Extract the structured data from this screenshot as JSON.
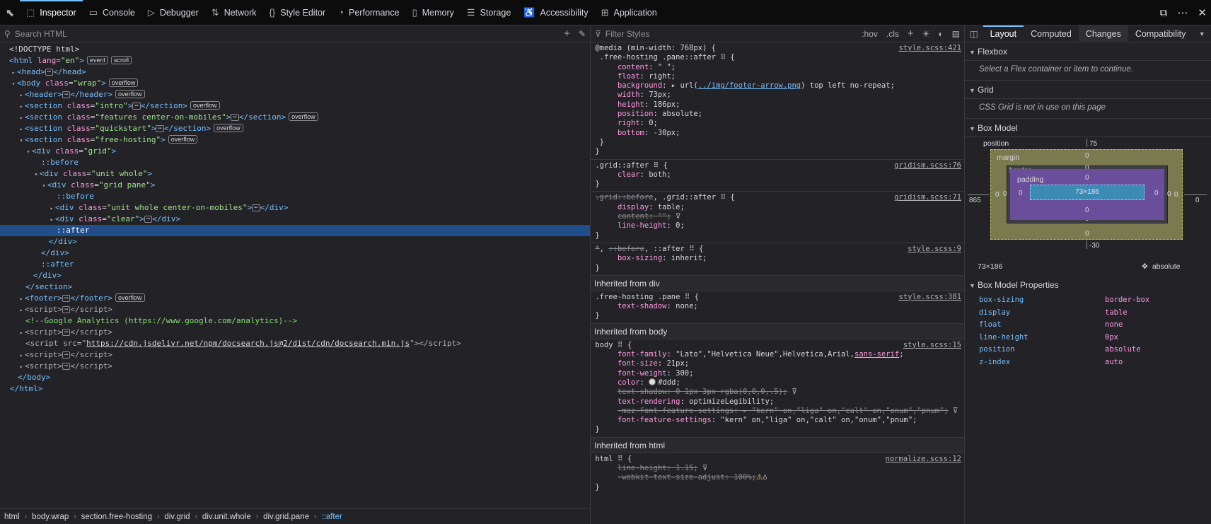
{
  "toolbar": {
    "tabs": [
      {
        "label": "Inspector",
        "icon": "inspector-icon",
        "glyph": "⬚"
      },
      {
        "label": "Console",
        "icon": "console-icon",
        "glyph": "▭"
      },
      {
        "label": "Debugger",
        "icon": "debugger-icon",
        "glyph": "▷"
      },
      {
        "label": "Network",
        "icon": "network-icon",
        "glyph": "⇅"
      },
      {
        "label": "Style Editor",
        "icon": "style-editor-icon",
        "glyph": "{}"
      },
      {
        "label": "Performance",
        "icon": "performance-icon",
        "glyph": "◔"
      },
      {
        "label": "Memory",
        "icon": "memory-icon",
        "glyph": "▯"
      },
      {
        "label": "Storage",
        "icon": "storage-icon",
        "glyph": "☰"
      },
      {
        "label": "Accessibility",
        "icon": "accessibility-icon",
        "glyph": "♿"
      },
      {
        "label": "Application",
        "icon": "application-icon",
        "glyph": "⊞"
      }
    ]
  },
  "markup": {
    "search_placeholder": "Search HTML",
    "breadcrumbs": [
      "html",
      "body.wrap",
      "section.free-hosting",
      "div.grid",
      "div.unit.whole",
      "div.grid.pane",
      "::after"
    ]
  },
  "rules": {
    "filter_placeholder": "Filter Styles",
    "hov": ":hov",
    "cls": ".cls",
    "inherited_div": "Inherited from div",
    "inherited_body": "Inherited from body",
    "inherited_html": "Inherited from html"
  },
  "layout": {
    "tabs": [
      "Layout",
      "Computed",
      "Changes",
      "Compatibility"
    ],
    "flexbox": "Flexbox",
    "flexbox_msg": "Select a Flex container or item to continue.",
    "grid": "Grid",
    "grid_msg": "CSS Grid is not in use on this page",
    "box_model": "Box Model",
    "position_label": "position",
    "margin_label": "margin",
    "border_label": "border",
    "padding_label": "padding",
    "content_size": "73×186",
    "pos_top": "75",
    "pos_bottom": "-30",
    "pos_left": "865",
    "pos_right": "0",
    "zero": "0",
    "size": "73×186",
    "position_value": "absolute",
    "props_title": "Box Model Properties",
    "props": [
      {
        "k": "box-sizing",
        "v": "border-box"
      },
      {
        "k": "display",
        "v": "table"
      },
      {
        "k": "float",
        "v": "none"
      },
      {
        "k": "line-height",
        "v": "0px"
      },
      {
        "k": "position",
        "v": "absolute"
      },
      {
        "k": "z-index",
        "v": "auto"
      }
    ]
  },
  "colors": {
    "accent": "#75bfff",
    "selection": "#204e8a",
    "property": "#ff97e1",
    "background": "#232327"
  }
}
